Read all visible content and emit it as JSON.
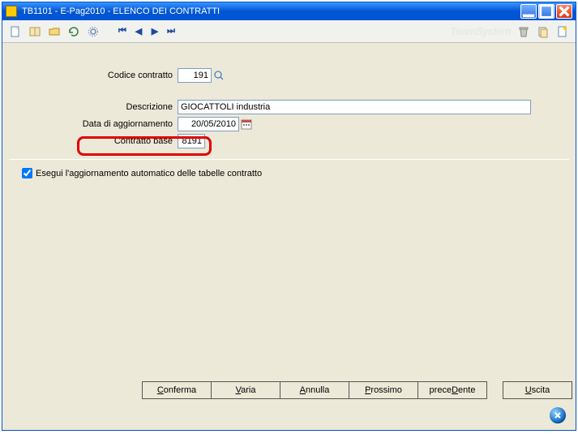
{
  "window": {
    "title": "TB1101  - E-Pag2010  -  ELENCO DEI CONTRATTI"
  },
  "brand": "TeamSystem",
  "form": {
    "codice_contratto_label": "Codice contratto",
    "codice_contratto_value": "191",
    "descrizione_label": "Descrizione",
    "descrizione_value": "GIOCATTOLI industria",
    "data_agg_label": "Data di aggiornamento",
    "data_agg_value": "20/05/2010",
    "contratto_base_label": "Contratto base",
    "contratto_base_value": "8191"
  },
  "checkbox": {
    "label": "Esegui l'aggiornamento automatico delle tabelle contratto",
    "checked": true
  },
  "buttons": {
    "conferma": "Conferma",
    "varia": "Varia",
    "annulla": "Annulla",
    "prossimo": "Prossimo",
    "precedente": "preceDente",
    "uscita": "Uscita"
  }
}
